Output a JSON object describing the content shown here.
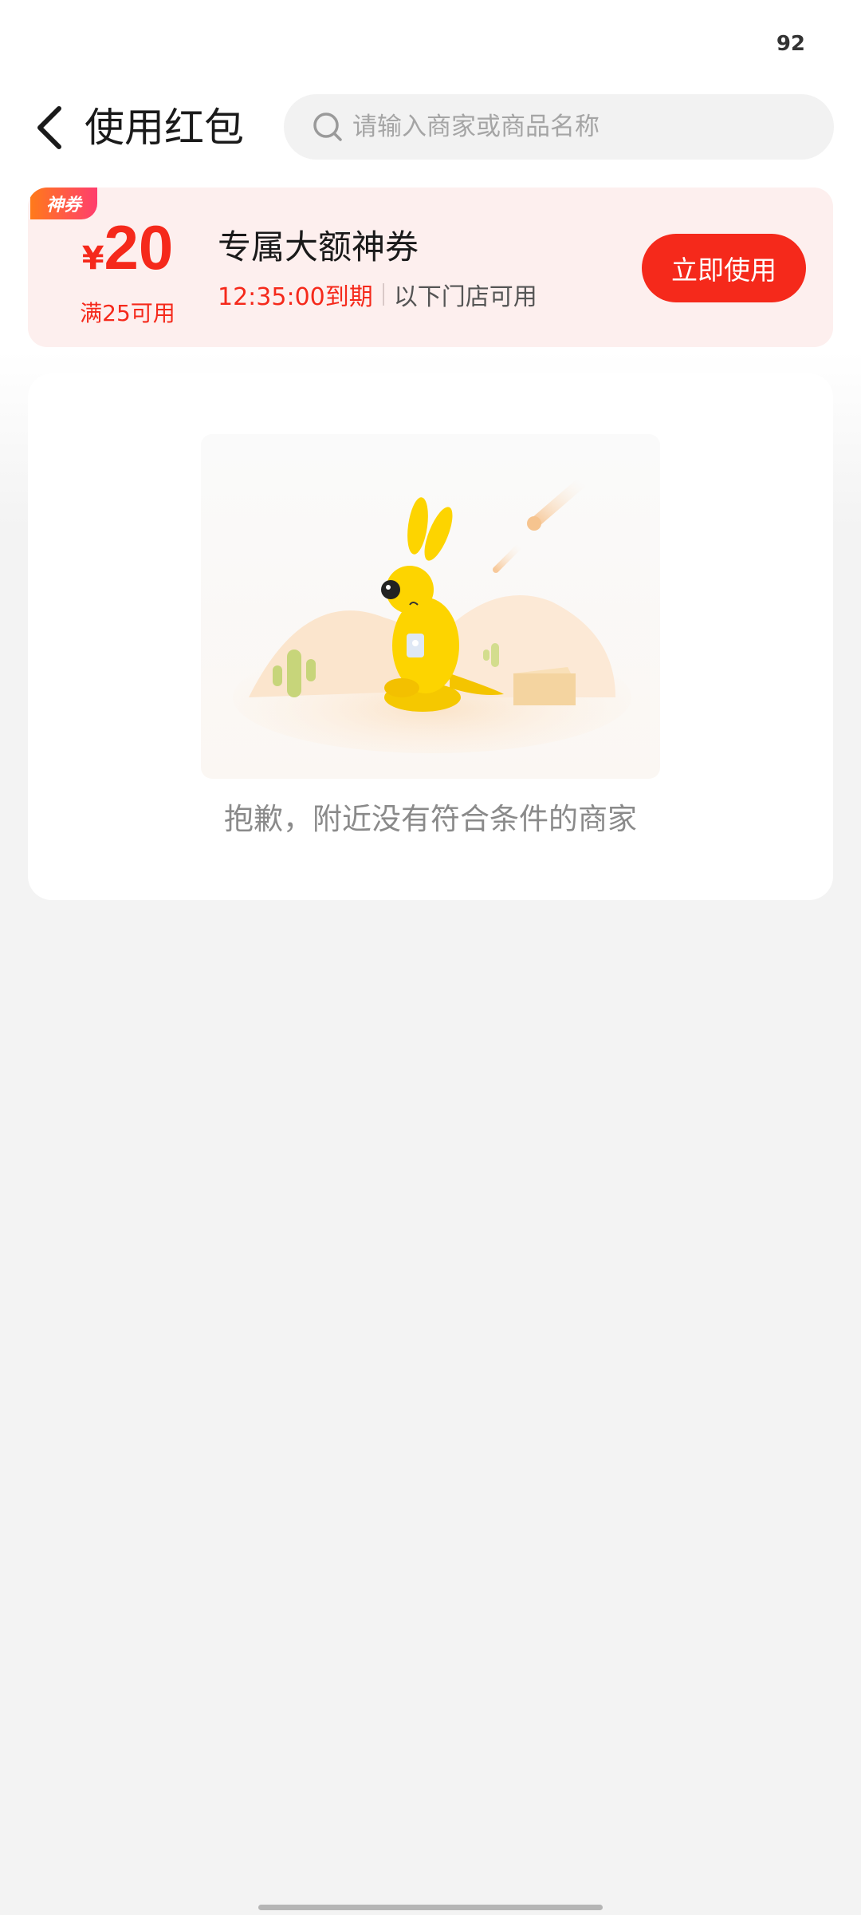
{
  "status_bar": {
    "battery": "92"
  },
  "header": {
    "back_icon": "chevron-left-icon",
    "title": "使用红包",
    "search": {
      "placeholder": "请输入商家或商品名称",
      "value": "",
      "icon": "search-icon"
    }
  },
  "coupon": {
    "tag": "神券",
    "currency": "¥",
    "amount": "20",
    "threshold": "满25可用",
    "title": "专属大额神券",
    "expire": "12:35:00到期",
    "scope": "以下门店可用",
    "button_label": "立即使用",
    "accent_color": "#f5291b"
  },
  "empty_state": {
    "illustration": "kangaroo-desert-illustration",
    "message": "抱歉，附近没有符合条件的商家"
  }
}
